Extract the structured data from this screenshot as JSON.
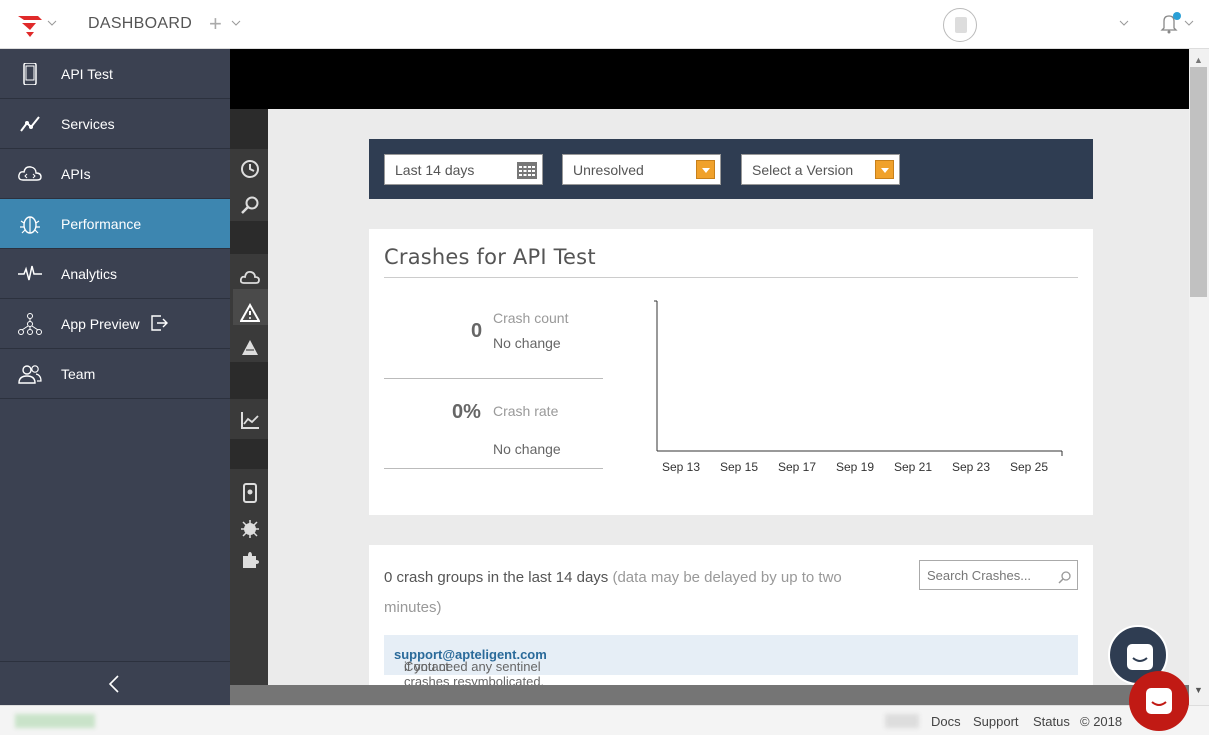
{
  "header": {
    "title": "DASHBOARD"
  },
  "sidebar": {
    "items": [
      {
        "label": "API Test",
        "icon": "phone-icon"
      },
      {
        "label": "Services",
        "icon": "services-icon"
      },
      {
        "label": "APIs",
        "icon": "cloud-code-icon"
      },
      {
        "label": "Performance",
        "icon": "bug-icon",
        "active": true
      },
      {
        "label": "Analytics",
        "icon": "pulse-icon"
      },
      {
        "label": "App Preview",
        "icon": "hierarchy-icon"
      },
      {
        "label": "Team",
        "icon": "team-icon"
      }
    ]
  },
  "filters": {
    "date_range": "Last 14 days",
    "status": "Unresolved",
    "version": "Select a Version"
  },
  "crashes": {
    "title": "Crashes for API Test",
    "crash_count": {
      "value": "0",
      "label": "Crash count",
      "change": "No change"
    },
    "crash_rate": {
      "value": "0%",
      "label": "Crash rate",
      "change": "No change"
    }
  },
  "chart_data": {
    "type": "line",
    "x": [
      "Sep 13",
      "Sep 15",
      "Sep 17",
      "Sep 19",
      "Sep 21",
      "Sep 23",
      "Sep 25"
    ],
    "series": [],
    "title": "",
    "xlabel": "",
    "ylabel": ""
  },
  "groups": {
    "summary": "0 crash groups in the last 14 days",
    "note": "(data may be delayed by up to two minutes)",
    "search_placeholder": "Search Crashes...",
    "notice_prefix": "Contact ",
    "notice_email": "support@apteligent.com",
    "notice_suffix": " if you need any sentinel crashes resymbolicated."
  },
  "footer": {
    "links": [
      "Docs",
      "Support",
      "Status"
    ],
    "copyright": "© 2018"
  },
  "colors": {
    "sidebar_bg": "#3b4151",
    "active_item": "#3d86b0",
    "filter_bar": "#2f3d52",
    "dropdown_accent": "#f0a12b",
    "chat_red": "#c11a14"
  }
}
